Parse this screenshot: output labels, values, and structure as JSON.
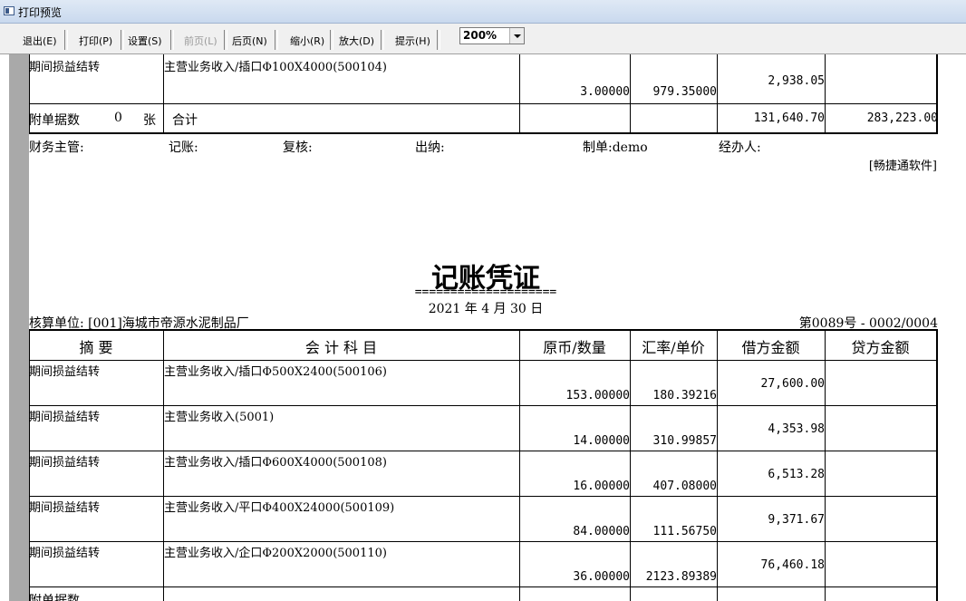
{
  "window": {
    "title": "打印预览"
  },
  "toolbar": {
    "exit": "退出(E)",
    "print": "打印(P)",
    "settings": "设置(S)",
    "prev": "前页(L)",
    "next": "后页(N)",
    "zoom_out": "缩小(R)",
    "zoom_in": "放大(D)",
    "hint": "提示(H)",
    "zoom_value": "200%"
  },
  "prev_page": {
    "row": {
      "summary": "期间损益结转",
      "account": "主营业务收入/插口Φ100X4000(500104)",
      "qty": "3.00000",
      "price": "979.35000",
      "debit": "2,938.05",
      "credit": ""
    },
    "footer_row": {
      "attach_label": "附单据数",
      "attach_count": "0",
      "attach_unit": "张",
      "total_label": "合计",
      "total_debit": "131,640.70",
      "total_credit": "283,223.00"
    },
    "signatures": {
      "finance": "财务主管:",
      "bookkeeper": "记账:",
      "review": "复核:",
      "cashier": "出纳:",
      "maker": "制单:demo",
      "handler": "经办人:"
    },
    "software": "[畅捷通软件]"
  },
  "voucher": {
    "title": "记账凭证",
    "underline": "====================",
    "date": "2021 年  4  月 30 日",
    "unit": "核算单位: [001]海城市帝源水泥制品厂",
    "number": "第0089号 - 0002/0004",
    "headers": {
      "summary": "摘    要",
      "account": "会  计  科  目",
      "qty": "原币/数量",
      "price": "汇率/单价",
      "debit": "借方金额",
      "credit": "贷方金额"
    },
    "rows": [
      {
        "summary": "期间损益结转",
        "account": "主营业务收入/插口Φ500X2400(500106)",
        "qty": "153.00000",
        "price": "180.39216",
        "debit": "27,600.00",
        "credit": ""
      },
      {
        "summary": "期间损益结转",
        "account": "主营业务收入(5001)",
        "qty": "14.00000",
        "price": "310.99857",
        "debit": "4,353.98",
        "credit": ""
      },
      {
        "summary": "期间损益结转",
        "account": "主营业务收入/插口Φ600X4000(500108)",
        "qty": "16.00000",
        "price": "407.08000",
        "debit": "6,513.28",
        "credit": ""
      },
      {
        "summary": "期间损益结转",
        "account": "主营业务收入/平口Φ400X24000(500109)",
        "qty": "84.00000",
        "price": "111.56750",
        "debit": "9,371.67",
        "credit": ""
      },
      {
        "summary": "期间损益结转",
        "account": "主营业务收入/企口Φ200X2000(500110)",
        "qty": "36.00000",
        "price": "2123.89389",
        "debit": "76,460.18",
        "credit": ""
      }
    ]
  }
}
